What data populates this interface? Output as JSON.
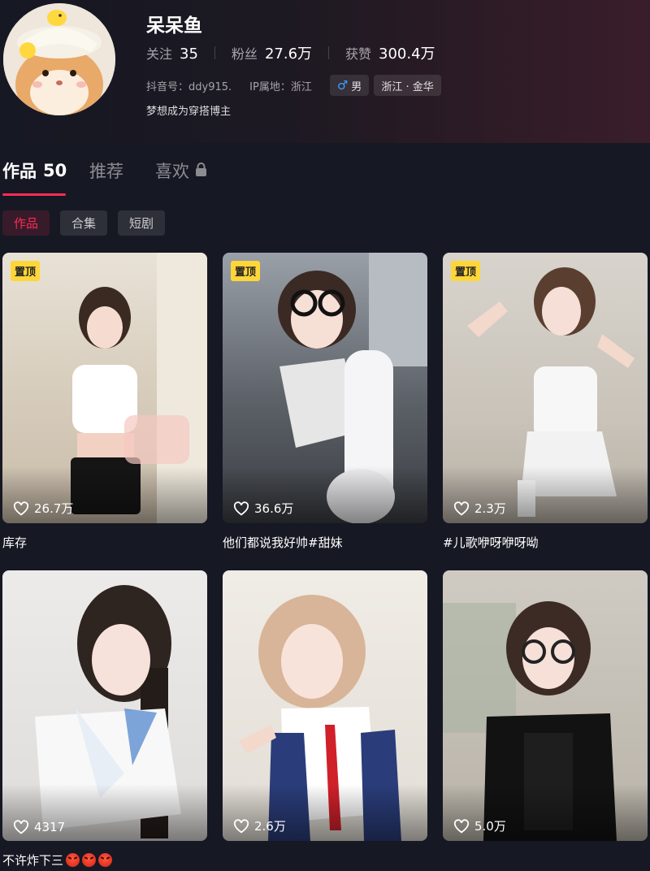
{
  "profile": {
    "nickname": "呆呆鱼",
    "stats": [
      {
        "label": "关注",
        "value": "35"
      },
      {
        "label": "粉丝",
        "value": "27.6万"
      },
      {
        "label": "获赞",
        "value": "300.4万"
      }
    ],
    "douyin_id": "抖音号：ddy915.",
    "ip_location": "IP属地：浙江",
    "gender_icon": "male-icon",
    "gender": "男",
    "region": "浙江 · 金华",
    "bio": "梦想成为穿搭博主",
    "avatar_icon": "hamster-avatar"
  },
  "tabs": [
    {
      "label": "作品",
      "count": "50"
    },
    {
      "label": "推荐"
    },
    {
      "label": "喜欢",
      "icon": "lock-icon"
    }
  ],
  "subtabs": [
    "作品",
    "合集",
    "短剧"
  ],
  "videos": [
    {
      "pinned": "置顶",
      "likes": "26.7万",
      "caption": "库存"
    },
    {
      "pinned": "置顶",
      "likes": "36.6万",
      "caption": "他们都说我好帅#甜妹"
    },
    {
      "pinned": "置顶",
      "likes": "2.3万",
      "caption": "#儿歌咿呀咿呀呦"
    },
    {
      "likes": "4317",
      "caption": "不许炸下三"
    },
    {
      "likes": "2.6万",
      "caption": ""
    },
    {
      "likes": "5.0万",
      "caption": ""
    }
  ],
  "colors": {
    "background": "#161823",
    "accent": "#fe2c55",
    "pin": "#ffd63a",
    "gender": "#3aa0ff"
  }
}
